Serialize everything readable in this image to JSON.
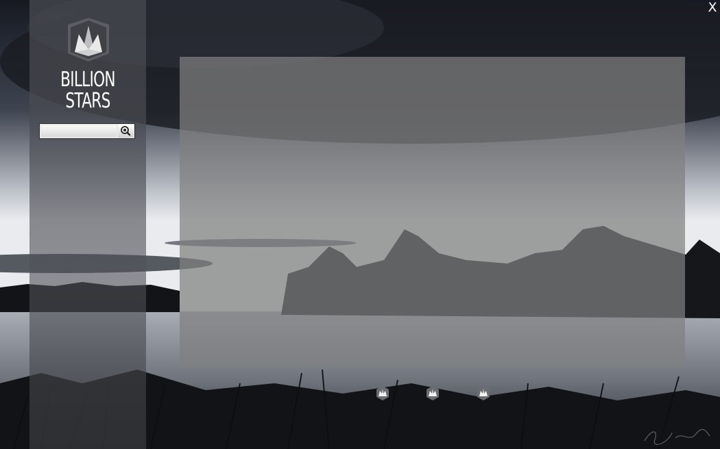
{
  "window": {
    "close_label": "X"
  },
  "brand": {
    "line1": "BILLION",
    "line2": "STARS",
    "logo_icon": "crown-logo-icon"
  },
  "search": {
    "placeholder": "",
    "value": "",
    "button_icon": "magnifier-search-icon"
  },
  "nav": {
    "icons": [
      "crown-icon",
      "crown-icon",
      "crown-icon"
    ]
  },
  "colors": {
    "panel": "#808080",
    "sidebar": "#46484e",
    "text": "#ffffff"
  }
}
